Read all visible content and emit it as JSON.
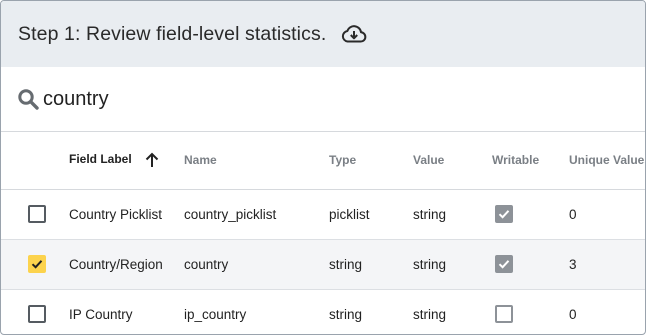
{
  "header": {
    "title": "Step 1: Review field-level statistics.",
    "download_icon": "cloud-download-icon"
  },
  "search": {
    "icon": "search-icon",
    "value": "country",
    "placeholder": ""
  },
  "table": {
    "columns": [
      {
        "key": "select",
        "label": ""
      },
      {
        "key": "field_label",
        "label": "Field Label",
        "sorted": "ascending"
      },
      {
        "key": "name",
        "label": "Name"
      },
      {
        "key": "type",
        "label": "Type"
      },
      {
        "key": "value",
        "label": "Value"
      },
      {
        "key": "writable",
        "label": "Writable"
      },
      {
        "key": "unique_values",
        "label": "Unique Values"
      }
    ],
    "rows": [
      {
        "selected": false,
        "field_label": "Country Picklist",
        "name": "country_picklist",
        "type": "picklist",
        "value": "string",
        "writable": true,
        "unique_values": "0"
      },
      {
        "selected": true,
        "field_label": "Country/Region",
        "name": "country",
        "type": "string",
        "value": "string",
        "writable": true,
        "unique_values": "3"
      },
      {
        "selected": false,
        "field_label": "IP Country",
        "name": "ip_country",
        "type": "string",
        "value": "string",
        "writable": false,
        "unique_values": "0"
      }
    ]
  },
  "colors": {
    "header_bg": "#e9edf1",
    "selected_checkbox": "#fcd34d",
    "writable_checkbox": "#8d9298"
  }
}
